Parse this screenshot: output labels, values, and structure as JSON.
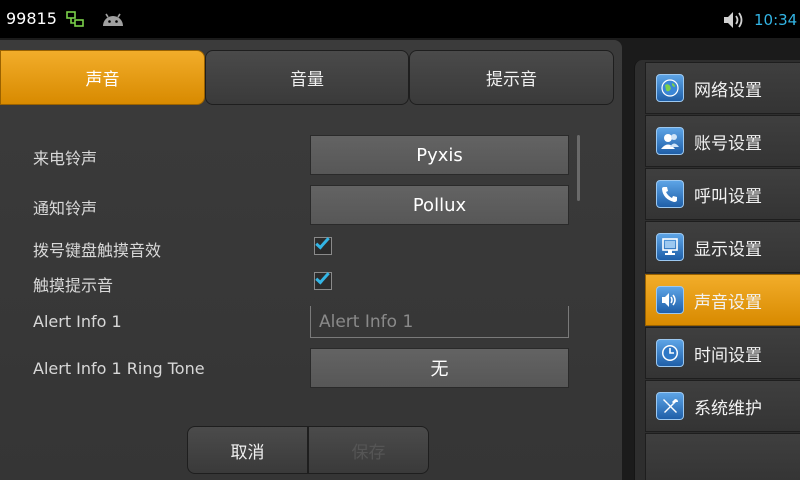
{
  "status_bar": {
    "id_text": "99815",
    "time": "10:34",
    "icons": [
      "network-icon",
      "android-icon",
      "volume-icon"
    ]
  },
  "tabs": [
    {
      "label": "声音",
      "active": true
    },
    {
      "label": "音量",
      "active": false
    },
    {
      "label": "提示音",
      "active": false
    }
  ],
  "settings": {
    "incoming_ringtone": {
      "label": "来电铃声",
      "value": "Pyxis"
    },
    "notification_ringtone": {
      "label": "通知铃声",
      "value": "Pollux"
    },
    "dialpad_touch_sound": {
      "label": "拨号键盘触摸音效",
      "checked": true
    },
    "touch_sound": {
      "label": "触摸提示音",
      "checked": true
    },
    "alert_info": {
      "label": "Alert Info 1",
      "placeholder": "Alert Info 1",
      "value": ""
    },
    "alert_info_ringtone": {
      "label": "Alert Info 1 Ring Tone",
      "value": "无"
    }
  },
  "buttons": {
    "cancel": "取消",
    "save": "保存"
  },
  "side_menu": [
    {
      "label": "网络设置",
      "icon": "globe-icon",
      "active": false
    },
    {
      "label": "账号设置",
      "icon": "user-icon",
      "active": false
    },
    {
      "label": "呼叫设置",
      "icon": "phone-icon",
      "active": false
    },
    {
      "label": "显示设置",
      "icon": "monitor-icon",
      "active": false
    },
    {
      "label": "声音设置",
      "icon": "speaker-icon",
      "active": true
    },
    {
      "label": "时间设置",
      "icon": "clock-icon",
      "active": false
    },
    {
      "label": "系统维护",
      "icon": "tools-icon",
      "active": false
    }
  ],
  "colors": {
    "accent": "#E9A11A",
    "check": "#33B5E5",
    "time": "#33B5E5"
  }
}
